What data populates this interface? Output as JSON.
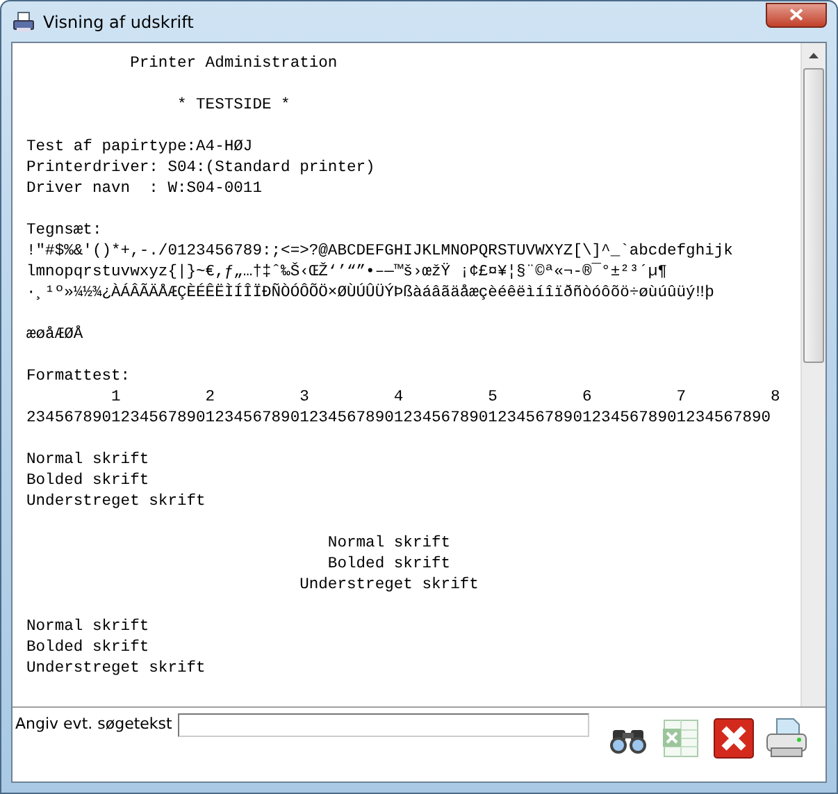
{
  "window": {
    "title": "Visning af udskrift"
  },
  "document": {
    "blocks": [
      [
        "           Printer Administration"
      ],
      [
        "                * TESTSIDE *"
      ],
      [
        "Test af papirtype:A4-HØJ",
        "Printerdriver: S04:(Standard printer)",
        "Driver navn  : W:S04-0011"
      ],
      [
        "Tegnsæt:",
        "!\"#$%&'()*+,-./0123456789:;<=>?@ABCDEFGHIJKLMNOPQRSTUVWXYZ[\\]^_`abcdefghijk",
        "lmnopqrstuvwxyz{|}~€,ƒ„…†‡ˆ‰Š‹ŒŽ‘’“”•–—™š›œžŸ ¡¢£¤¥¦§¨©ª«¬-®¯°±²³´µ¶",
        "·¸¹º»¼½¾¿ÀÁÂÃÄÅÆÇÈÉÊËÌÍÎÏÐÑÒÓÔÕÖ×ØÙÚÛÜÝÞßàáâãäåæçèéêëìíîïðñòóôõö÷øùúûüý‼þ"
      ],
      [
        "æøåÆØÅ"
      ],
      [
        "Formattest:",
        "         1         2         3         4         5         6         7         8",
        "2345678901234567890123456789012345678901234567890123456789012345678901234567890"
      ],
      [
        "Normal skrift",
        "Bolded skrift",
        "Understreget skrift"
      ],
      [
        "                                Normal skrift",
        "                                Bolded skrift",
        "                             Understreget skrift"
      ],
      [
        "Normal skrift",
        "Bolded skrift",
        "Understreget skrift"
      ]
    ]
  },
  "search": {
    "label": "Angiv evt. søgetekst"
  }
}
